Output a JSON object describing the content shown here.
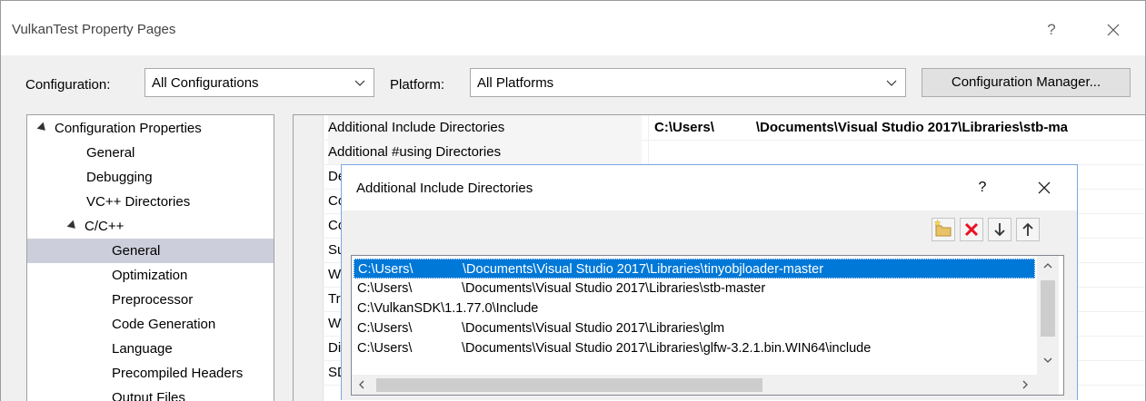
{
  "window": {
    "title": "VulkanTest Property Pages",
    "help_label": "?"
  },
  "toolbar": {
    "configuration_label": "Configuration:",
    "configuration_value": "All Configurations",
    "platform_label": "Platform:",
    "platform_value": "All Platforms",
    "config_manager_label": "Configuration Manager..."
  },
  "tree": {
    "items": [
      {
        "label": "Configuration Properties",
        "expanded": true
      },
      {
        "label": "General"
      },
      {
        "label": "Debugging"
      },
      {
        "label": "VC++ Directories"
      },
      {
        "label": "C/C++",
        "expanded": true
      },
      {
        "label": "General",
        "selected": true
      },
      {
        "label": "Optimization"
      },
      {
        "label": "Preprocessor"
      },
      {
        "label": "Code Generation"
      },
      {
        "label": "Language"
      },
      {
        "label": "Precompiled Headers"
      },
      {
        "label": "Output Files"
      }
    ]
  },
  "grid": {
    "rows": [
      {
        "name": "Additional Include Directories",
        "value_a": "C:\\Users\\",
        "value_b": "\\Documents\\Visual Studio 2017\\Libraries\\stb-ma"
      },
      {
        "name": "Additional #using Directories",
        "value_a": "",
        "value_b": ""
      },
      {
        "name": "De",
        "value_a": "",
        "value_b": ""
      },
      {
        "name": "Co",
        "value_a": "",
        "value_b": ""
      },
      {
        "name": "Co",
        "value_a": "",
        "value_b": ""
      },
      {
        "name": "Su",
        "value_a": "",
        "value_b": ""
      },
      {
        "name": "W",
        "value_a": "",
        "value_b": ""
      },
      {
        "name": "Tr",
        "value_a": "",
        "value_b": ""
      },
      {
        "name": "W",
        "value_a": "",
        "value_b": ""
      },
      {
        "name": "Di",
        "value_a": "",
        "value_b": ""
      },
      {
        "name": "SD",
        "value_a": "",
        "value_b": ""
      }
    ]
  },
  "dialog": {
    "title": "Additional Include Directories",
    "help_label": "?",
    "toolbar_icons": [
      "new-folder-icon",
      "delete-icon",
      "move-down-icon",
      "move-up-icon"
    ],
    "directories": [
      {
        "a": "C:\\Users\\",
        "b": "\\Documents\\Visual Studio 2017\\Libraries\\tinyobjloader-master",
        "selected": true
      },
      {
        "a": "C:\\Users\\",
        "b": "\\Documents\\Visual Studio 2017\\Libraries\\stb-master"
      },
      {
        "a": "C:\\VulkanSDK\\1.1.77.0\\Include",
        "b": ""
      },
      {
        "a": "C:\\Users\\",
        "b": "\\Documents\\Visual Studio 2017\\Libraries\\glm"
      },
      {
        "a": "C:\\Users\\",
        "b": "\\Documents\\Visual Studio 2017\\Libraries\\glfw-3.2.1.bin.WIN64\\include"
      }
    ]
  },
  "colors": {
    "selection": "#0078d7",
    "tree_selection": "#cccedb",
    "dialog_border": "#7fa5e0",
    "delete_red": "#e81123"
  }
}
